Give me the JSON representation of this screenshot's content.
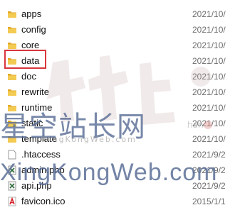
{
  "files": [
    {
      "name": "apps",
      "date": "2021/10/",
      "icon": "folder-icon"
    },
    {
      "name": "config",
      "date": "2021/10/",
      "icon": "folder-icon"
    },
    {
      "name": "core",
      "date": "2021/10/",
      "icon": "folder-icon"
    },
    {
      "name": "data",
      "date": "2021/10/",
      "icon": "folder-icon"
    },
    {
      "name": "doc",
      "date": "2021/10/",
      "icon": "folder-icon"
    },
    {
      "name": "rewrite",
      "date": "2021/10/",
      "icon": "folder-icon"
    },
    {
      "name": "runtime",
      "date": "2021/10/",
      "icon": "folder-icon"
    },
    {
      "name": "static",
      "date": "2021/10/",
      "icon": "folder-icon"
    },
    {
      "name": "template",
      "date": "2021/10/",
      "icon": "folder-icon"
    },
    {
      "name": ".htaccess",
      "date": "2021/9/2",
      "icon": "file-icon"
    },
    {
      "name": "admin.php",
      "date": "2021/9/2",
      "icon": "php-file-icon"
    },
    {
      "name": "api.php",
      "date": "2021/9/2",
      "icon": "php-file-icon"
    },
    {
      "name": "favicon.ico",
      "date": "2015/1/1",
      "icon": "ico-file-icon"
    }
  ],
  "highlighted_item": "data",
  "watermark": {
    "chinese_text": "星空站长网",
    "url_text": "XingKongWeb.com",
    "small_text": "XingKongWeb.com",
    "small_right": "han"
  },
  "colors": {
    "folder": "#f4cb52",
    "folder_dark": "#e2a928",
    "highlight": "#d9353b",
    "text": "#111111",
    "date_text": "#6d6d6d"
  }
}
